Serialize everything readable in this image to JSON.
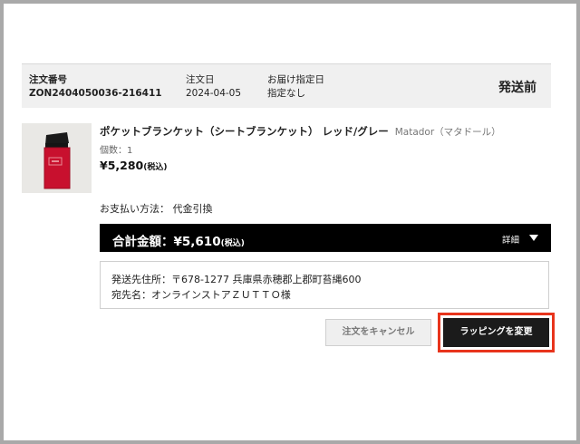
{
  "order": {
    "number_label": "注文番号",
    "number": "ZON2404050036-216411",
    "date_label": "注文日",
    "date": "2024-04-05",
    "delivery_label": "お届け指定日",
    "delivery": "指定なし",
    "status": "発送前"
  },
  "product": {
    "image_icon": "product-photo",
    "name": "ポケットブランケット（シートブランケット） レッド/グレー",
    "brand": "Matador（マタドール）",
    "qty_text": "個数：1",
    "price": "¥5,280",
    "tax_note": "(税込)"
  },
  "payment": {
    "text": "お支払い方法： 代金引換"
  },
  "total": {
    "label": "合計金額：¥5,610",
    "tax_note": "(税込)",
    "detail": "詳細",
    "detail_icon": "triangle-down-icon"
  },
  "shipping": {
    "address": "発送先住所：〒678-1277 兵庫県赤穂郡上郡町苔縄600",
    "recipient": "宛先名：オンラインストアＺＵＴＴＯ様"
  },
  "actions": {
    "cancel": "注文をキャンセル",
    "wrapping": "ラッピングを変更"
  },
  "colors": {
    "highlight": "#e8341c",
    "product_red": "#c8102e",
    "header_bg": "#f0f0f0"
  }
}
